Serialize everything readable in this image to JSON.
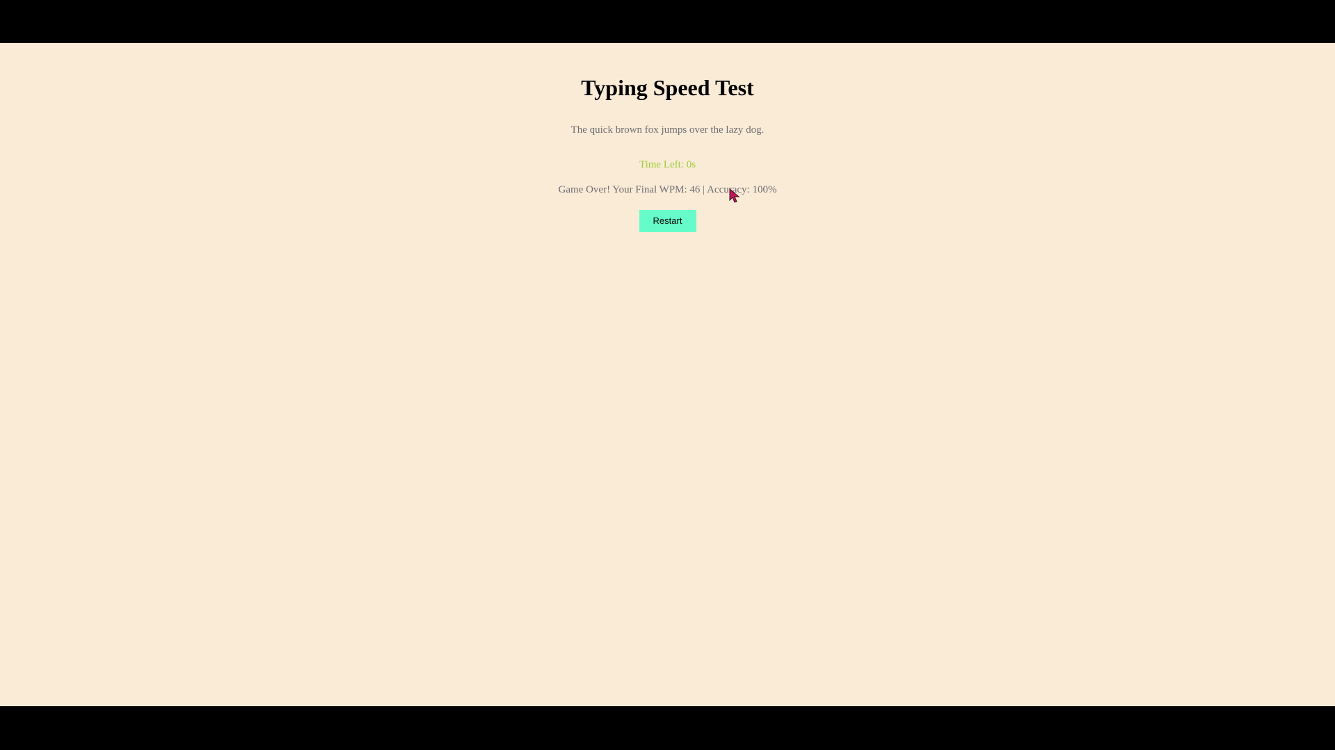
{
  "game": {
    "title": "Typing Speed Test",
    "sentence": "The quick brown fox jumps over the lazy dog.",
    "timer_text": "Time Left: 0s",
    "time_left_seconds": 0,
    "result_text": "Game Over! Your Final WPM: 46 | Accuracy: 100%",
    "final_wpm": 46,
    "accuracy_percent": 100,
    "restart_label": "Restart"
  },
  "colors": {
    "page_background": "#faebd7",
    "letterbox": "#000000",
    "timer": "#9acd32",
    "button": "#66fcc9",
    "muted_text": "#6e6e6e"
  },
  "icons": {
    "cursor": "mouse-pointer-icon"
  }
}
